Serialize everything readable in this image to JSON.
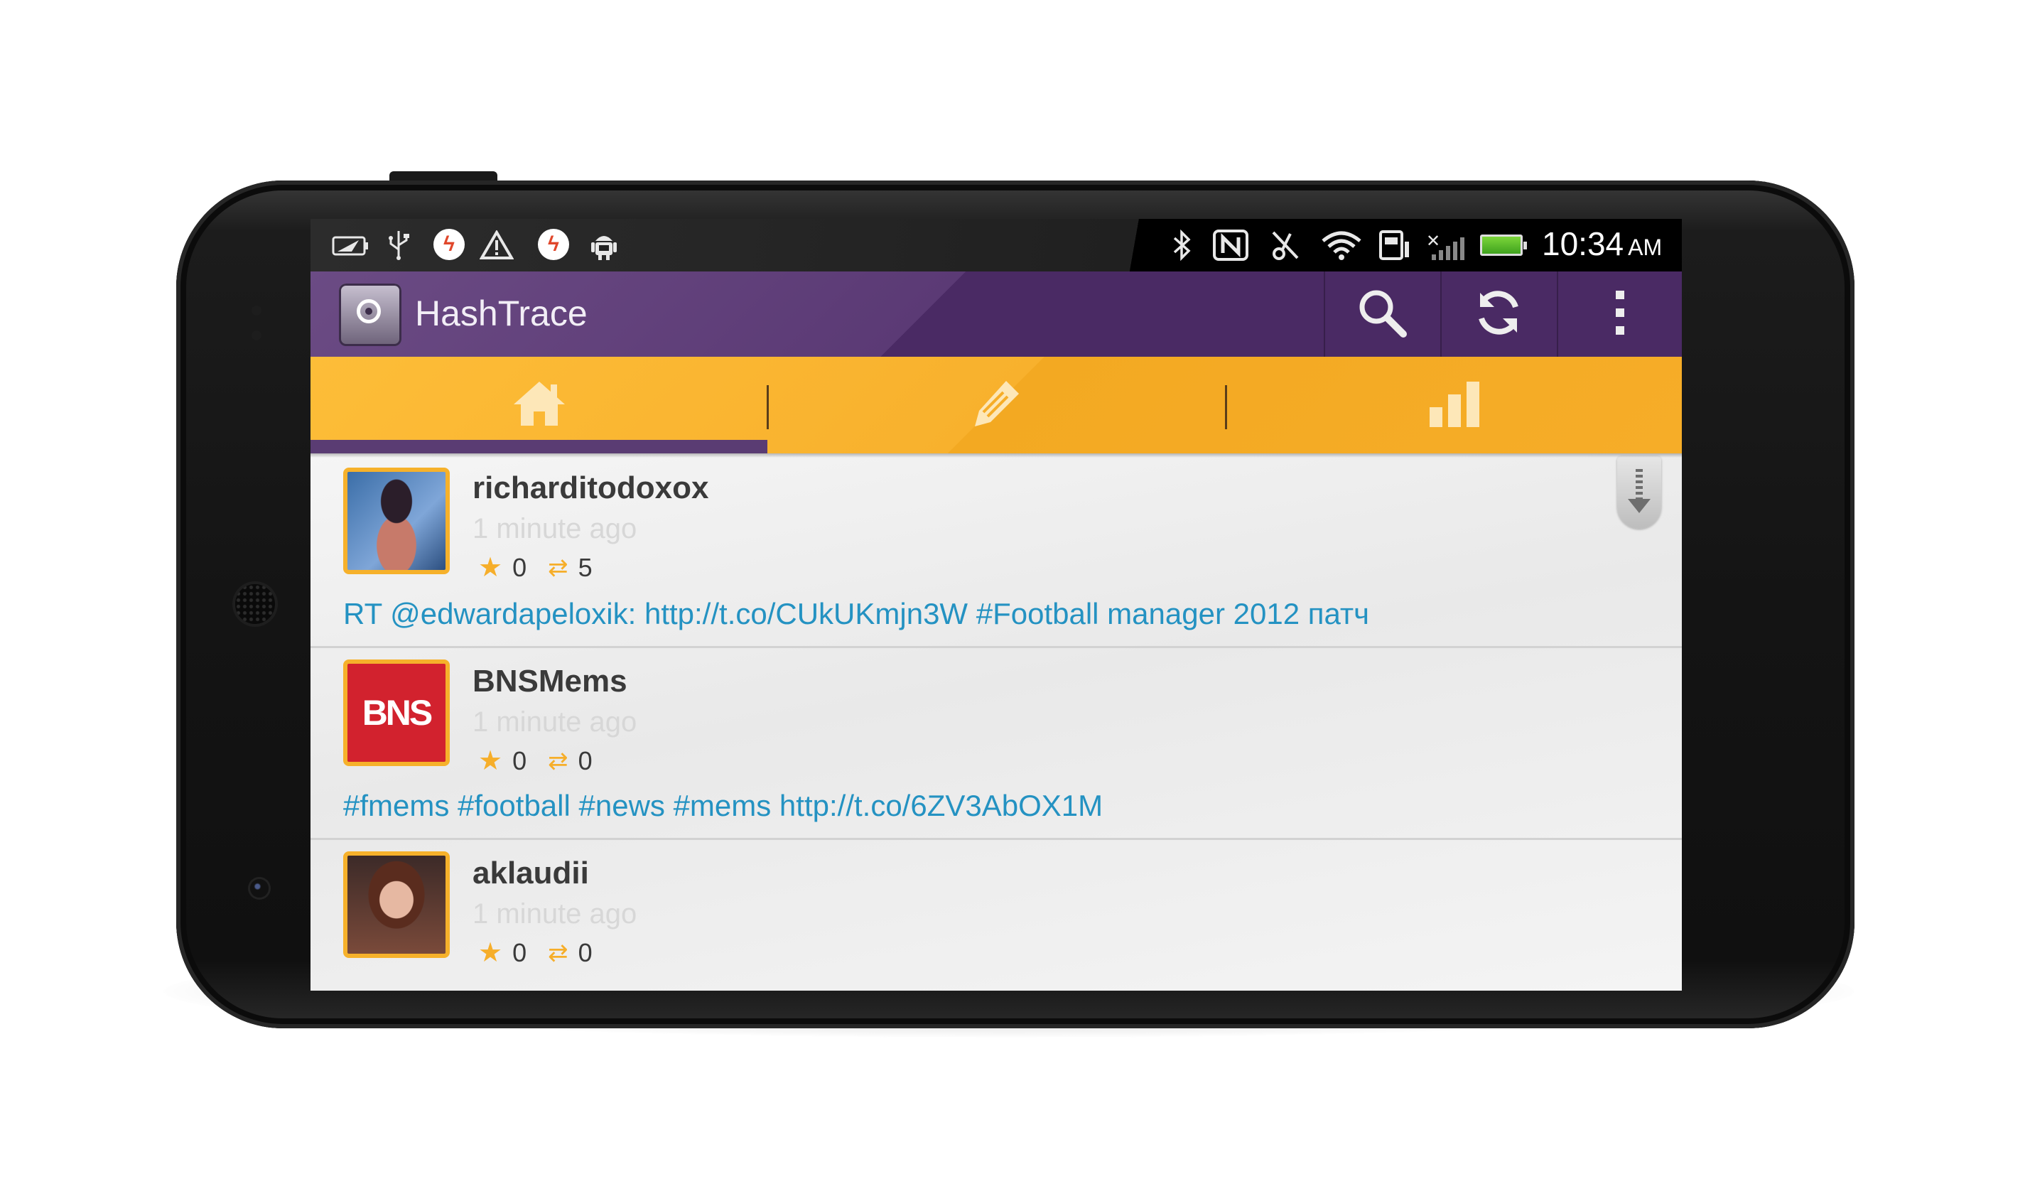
{
  "status_bar": {
    "time": "10:34",
    "ampm": "AM"
  },
  "app": {
    "title": "HashTrace",
    "actions": [
      "search-icon",
      "refresh-icon",
      "overflow-menu-icon"
    ]
  },
  "tabs": [
    {
      "icon": "home-icon",
      "selected": true
    },
    {
      "icon": "pencil-icon",
      "selected": false
    },
    {
      "icon": "stats-icon",
      "selected": false
    }
  ],
  "colors": {
    "action_bar": "#4a2a64",
    "tab_bar": "#f6ad28",
    "link_text": "#2492c2"
  },
  "tweets": [
    {
      "username": "richarditodoxox",
      "time": "1 minute ago",
      "favorites": "0",
      "retweets": "5",
      "text": "RT @edwardapeloxik: http://t.co/CUkUKmjn3W #Football manager 2012 патч"
    },
    {
      "username": "BNSMems",
      "time": "1 minute ago",
      "favorites": "0",
      "retweets": "0",
      "text": "#fmems #football #news #mems http://t.co/6ZV3AbOX1M",
      "avatar_text": "BNS"
    },
    {
      "username": "aklaudii",
      "time": "1 minute ago",
      "favorites": "0",
      "retweets": "0"
    }
  ]
}
